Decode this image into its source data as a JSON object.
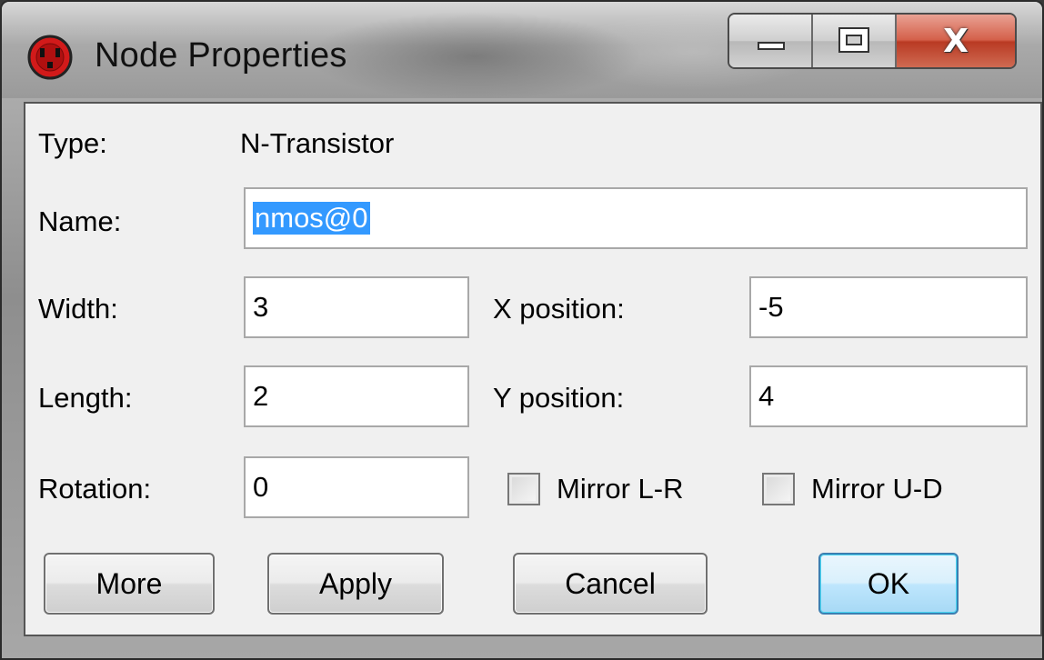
{
  "window": {
    "title": "Node Properties",
    "app_icon": "red-power-socket-icon",
    "controls": {
      "minimize": "minimize-icon",
      "maximize": "maximize-icon",
      "close": "close-icon",
      "close_glyph": "X"
    }
  },
  "form": {
    "type_label": "Type:",
    "type_value": "N-Transistor",
    "name_label": "Name:",
    "name_value": "nmos@0",
    "width_label": "Width:",
    "width_value": "3",
    "length_label": "Length:",
    "length_value": "2",
    "rotation_label": "Rotation:",
    "rotation_value": "0",
    "x_position_label": "X position:",
    "x_position_value": "-5",
    "y_position_label": "Y position:",
    "y_position_value": "4",
    "mirror_lr_label": "Mirror L-R",
    "mirror_lr_checked": false,
    "mirror_ud_label": "Mirror U-D",
    "mirror_ud_checked": false
  },
  "buttons": {
    "more": "More",
    "apply": "Apply",
    "cancel": "Cancel",
    "ok": "OK"
  },
  "colors": {
    "selection": "#3399ff",
    "default_button_border": "#3c7fb1",
    "close_button": "#c7452e"
  }
}
